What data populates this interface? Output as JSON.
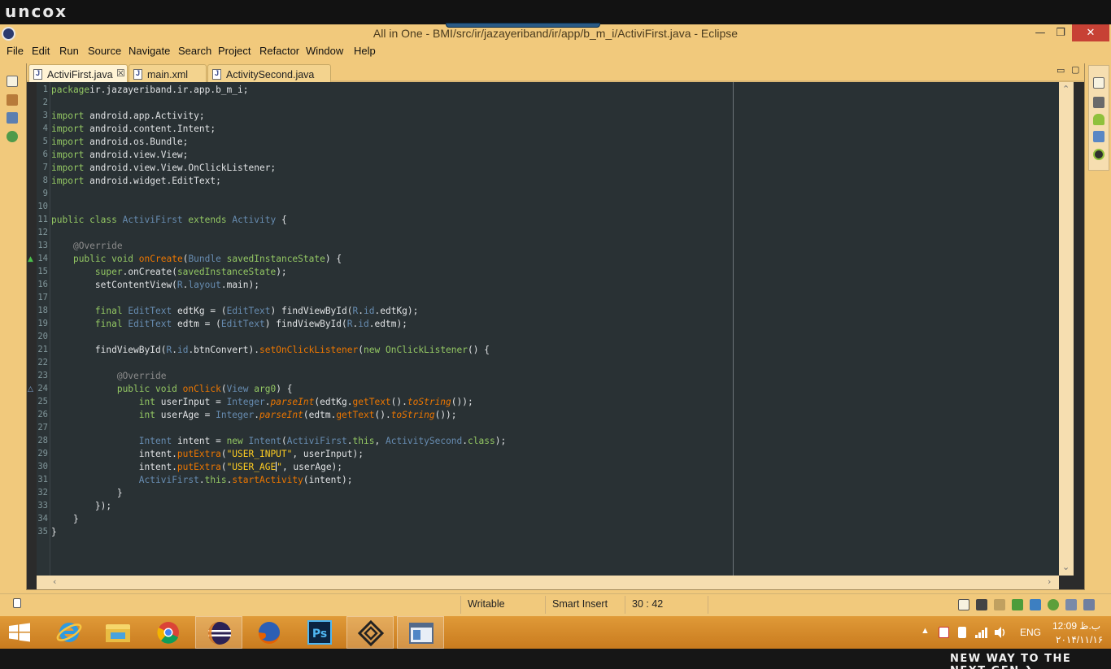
{
  "watermark": {
    "logo": "uncox",
    "slogan": "NEW WAY TO THE NEXT GEN ❯"
  },
  "window": {
    "title": "All in One - BMI/src/ir/jazayeriband/ir/app/b_m_i/ActiviFirst.java - Eclipse",
    "minimize": "—",
    "restore": "❐",
    "close": "✕"
  },
  "menu": [
    "File",
    "Edit",
    "Run",
    "Source",
    "Navigate",
    "Search",
    "Project",
    "Refactor",
    "Window",
    "Help"
  ],
  "tabs": [
    {
      "label": "ActiviFirst.java",
      "active": true,
      "icon": "java-file-icon"
    },
    {
      "label": "main.xml",
      "active": false,
      "icon": "xml-file-icon"
    },
    {
      "label": "ActivitySecond.java",
      "active": false,
      "icon": "java-file-icon"
    }
  ],
  "status": {
    "writable": "Writable",
    "insert_mode": "Smart Insert",
    "position": "30 : 42"
  },
  "tray": {
    "language": "ENG",
    "time": "12:09 ب.ظ",
    "date": "۲۰۱۴/۱۱/۱۶"
  },
  "colors": {
    "editor_bg": "#293134",
    "chrome": "#f1c97c",
    "taskbar": "#d68a2a",
    "close_button": "#c74135"
  },
  "line_numbers": [
    "1",
    "2",
    "3",
    "4",
    "5",
    "6",
    "7",
    "8",
    "9",
    "10",
    "11",
    "12",
    "13",
    "14",
    "15",
    "16",
    "17",
    "18",
    "19",
    "20",
    "21",
    "22",
    "23",
    "24",
    "25",
    "26",
    "27",
    "28",
    "29",
    "30",
    "31",
    "32",
    "33",
    "34",
    "35"
  ],
  "code": [
    [
      [
        "kw",
        "package"
      ],
      [
        "",
        "ir.jazayeriband.ir.app.b_m_i;"
      ]
    ],
    [],
    [
      [
        "kw",
        "import"
      ],
      [
        "",
        " android.app.Activity;"
      ]
    ],
    [
      [
        "kw",
        "import"
      ],
      [
        "",
        " android.content.Intent;"
      ]
    ],
    [
      [
        "kw",
        "import"
      ],
      [
        "",
        " android.os.Bundle;"
      ]
    ],
    [
      [
        "kw",
        "import"
      ],
      [
        "",
        " android.view.View;"
      ]
    ],
    [
      [
        "kw",
        "import"
      ],
      [
        "",
        " android.view.View.OnClickListener;"
      ]
    ],
    [
      [
        "kw",
        "import"
      ],
      [
        "",
        " android.widget.EditText;"
      ]
    ],
    [],
    [],
    [
      [
        "kw",
        "public class"
      ],
      [
        "",
        " "
      ],
      [
        "ty",
        "ActiviFirst"
      ],
      [
        "",
        " "
      ],
      [
        "kw",
        "extends"
      ],
      [
        "",
        " "
      ],
      [
        "ty",
        "Activity"
      ],
      [
        "",
        " {"
      ]
    ],
    [],
    [
      [
        "",
        "    "
      ],
      [
        "an",
        "@Override"
      ]
    ],
    [
      [
        "",
        "    "
      ],
      [
        "kw",
        "public void"
      ],
      [
        "",
        " "
      ],
      [
        "mc",
        "onCreate"
      ],
      [
        "",
        "("
      ],
      [
        "ty",
        "Bundle"
      ],
      [
        "",
        " "
      ],
      [
        "kw",
        "savedInstanceState"
      ],
      [
        "",
        ") {"
      ]
    ],
    [
      [
        "",
        "        "
      ],
      [
        "kw",
        "super"
      ],
      [
        "",
        ".onCreate("
      ],
      [
        "kw",
        "savedInstanceState"
      ],
      [
        "",
        ");"
      ]
    ],
    [
      [
        "",
        "        setContentView("
      ],
      [
        "ty",
        "R"
      ],
      [
        "",
        "."
      ],
      [
        "ty",
        "layout"
      ],
      [
        "",
        ".main);"
      ]
    ],
    [],
    [
      [
        "",
        "        "
      ],
      [
        "kw",
        "final"
      ],
      [
        "",
        " "
      ],
      [
        "ty",
        "EditText"
      ],
      [
        "",
        " edtKg = ("
      ],
      [
        "ty",
        "EditText"
      ],
      [
        "",
        ") findViewById("
      ],
      [
        "ty",
        "R"
      ],
      [
        "",
        "."
      ],
      [
        "ty",
        "id"
      ],
      [
        "",
        ".edtKg);"
      ]
    ],
    [
      [
        "",
        "        "
      ],
      [
        "kw",
        "final"
      ],
      [
        "",
        " "
      ],
      [
        "ty",
        "EditText"
      ],
      [
        "",
        " edtm = ("
      ],
      [
        "ty",
        "EditText"
      ],
      [
        "",
        ") findViewById("
      ],
      [
        "ty",
        "R"
      ],
      [
        "",
        "."
      ],
      [
        "ty",
        "id"
      ],
      [
        "",
        ".edtm);"
      ]
    ],
    [],
    [
      [
        "",
        "        findViewById("
      ],
      [
        "ty",
        "R"
      ],
      [
        "",
        "."
      ],
      [
        "ty",
        "id"
      ],
      [
        "",
        ".btnConvert)."
      ],
      [
        "mc",
        "setOnClickListener"
      ],
      [
        "",
        "("
      ],
      [
        "kw",
        "new"
      ],
      [
        "",
        " "
      ],
      [
        "kw",
        "OnClickListener"
      ],
      [
        "",
        "() {"
      ]
    ],
    [],
    [
      [
        "",
        "            "
      ],
      [
        "an",
        "@Override"
      ]
    ],
    [
      [
        "",
        "            "
      ],
      [
        "kw",
        "public void"
      ],
      [
        "",
        " "
      ],
      [
        "mc",
        "onClick"
      ],
      [
        "",
        "("
      ],
      [
        "ty",
        "View"
      ],
      [
        "",
        " "
      ],
      [
        "kw",
        "arg0"
      ],
      [
        "",
        ") {"
      ]
    ],
    [
      [
        "",
        "                "
      ],
      [
        "kw",
        "int"
      ],
      [
        "",
        " userInput = "
      ],
      [
        "ty",
        "Integer"
      ],
      [
        "",
        "."
      ],
      [
        "it",
        "parseInt"
      ],
      [
        "",
        "(edtKg."
      ],
      [
        "mc",
        "getText"
      ],
      [
        "",
        "()."
      ],
      [
        "it",
        "toString"
      ],
      [
        "",
        "());"
      ]
    ],
    [
      [
        "",
        "                "
      ],
      [
        "kw",
        "int"
      ],
      [
        "",
        " userAge = "
      ],
      [
        "ty",
        "Integer"
      ],
      [
        "",
        "."
      ],
      [
        "it",
        "parseInt"
      ],
      [
        "",
        "(edtm."
      ],
      [
        "mc",
        "getText"
      ],
      [
        "",
        "()."
      ],
      [
        "it",
        "toString"
      ],
      [
        "",
        "());"
      ]
    ],
    [],
    [
      [
        "",
        "                "
      ],
      [
        "ty",
        "Intent"
      ],
      [
        "",
        " intent = "
      ],
      [
        "kw",
        "new"
      ],
      [
        "",
        " "
      ],
      [
        "ty",
        "Intent"
      ],
      [
        "",
        "("
      ],
      [
        "ty",
        "ActiviFirst"
      ],
      [
        "",
        "."
      ],
      [
        "kw",
        "this"
      ],
      [
        "",
        ", "
      ],
      [
        "ty",
        "ActivitySecond"
      ],
      [
        "",
        "."
      ],
      [
        "kw",
        "class"
      ],
      [
        "",
        ");"
      ]
    ],
    [
      [
        "",
        "                intent."
      ],
      [
        "mc",
        "putExtra"
      ],
      [
        "",
        "("
      ],
      [
        "st",
        "\"USER_INPUT\""
      ],
      [
        "",
        ", userInput);"
      ]
    ],
    [
      [
        "",
        "                intent."
      ],
      [
        "mc",
        "putExtra"
      ],
      [
        "",
        "("
      ],
      [
        "st",
        "\"USER_AGE"
      ],
      [
        "cursor",
        ""
      ],
      [
        "st",
        "\""
      ],
      [
        "",
        ", userAge);"
      ]
    ],
    [
      [
        "",
        "                "
      ],
      [
        "ty",
        "ActiviFirst"
      ],
      [
        "",
        "."
      ],
      [
        "kw",
        "this"
      ],
      [
        "",
        "."
      ],
      [
        "mc",
        "startActivity"
      ],
      [
        "",
        "(intent);"
      ]
    ],
    [
      [
        "",
        "            }"
      ]
    ],
    [
      [
        "",
        "        });"
      ]
    ],
    [
      [
        "",
        "    }"
      ]
    ],
    [
      [
        "",
        "}"
      ]
    ]
  ]
}
